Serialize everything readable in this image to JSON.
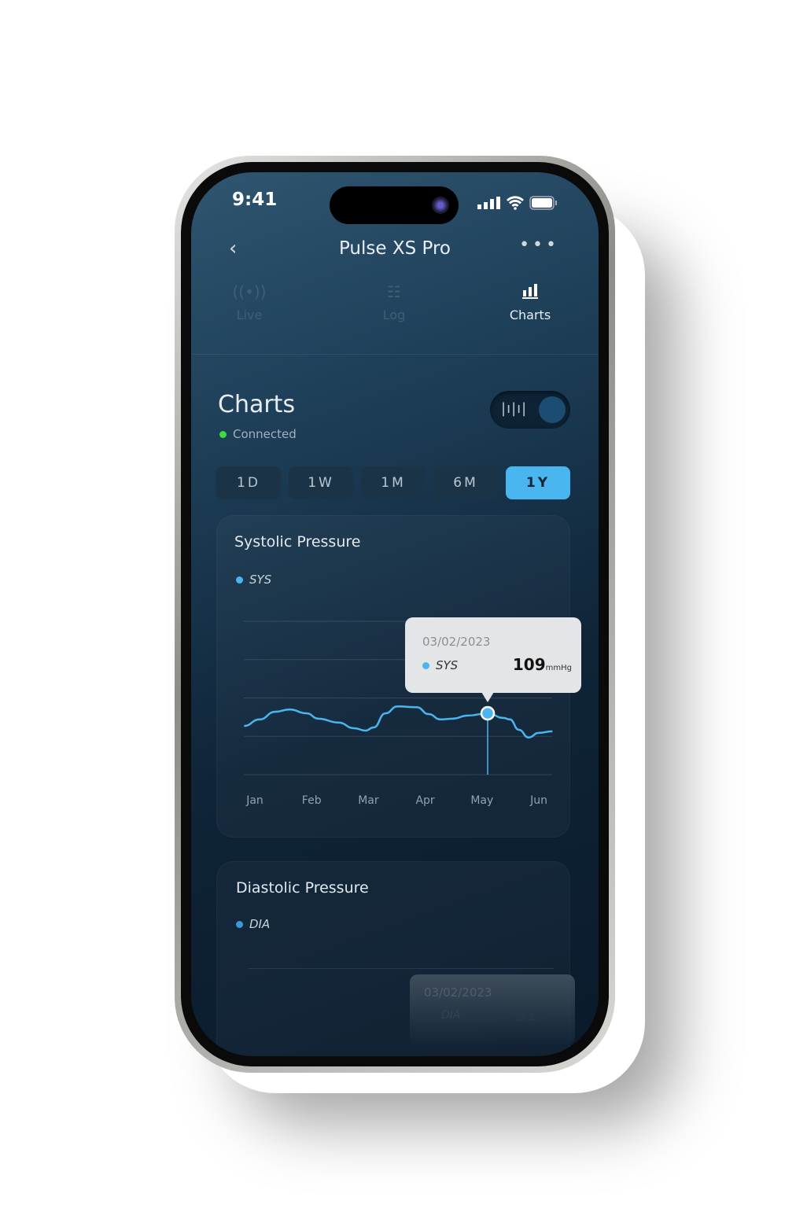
{
  "status_bar": {
    "time": "9:41"
  },
  "header": {
    "title": "Pulse XS Pro",
    "back_icon": "chevron-left-icon",
    "more_icon": "ellipsis-icon"
  },
  "tabs": [
    {
      "label": "Live",
      "icon": "broadcast-icon",
      "active": false
    },
    {
      "label": "Log",
      "icon": "document-icon",
      "active": false
    },
    {
      "label": "Charts",
      "icon": "bar-chart-icon",
      "active": true
    }
  ],
  "page": {
    "title": "Charts",
    "status": "Connected",
    "status_color": "#3ddc3d",
    "toggle_icon": "bars-icon"
  },
  "ranges": [
    {
      "label": "1D",
      "active": false
    },
    {
      "label": "1W",
      "active": false
    },
    {
      "label": "1M",
      "active": false
    },
    {
      "label": "6M",
      "active": false
    },
    {
      "label": "1Y",
      "active": true
    }
  ],
  "accent": "#4ab6f0",
  "systolic": {
    "title": "Systolic Pressure",
    "legend": "SYS",
    "tooltip": {
      "date": "03/02/2023",
      "series": "SYS",
      "value": "109",
      "unit": "mmHg"
    }
  },
  "diastolic": {
    "title": "Diastolic Pressure",
    "legend": "DIA",
    "tooltip": {
      "date": "03/02/2023",
      "series": "DIA",
      "value": "91"
    }
  },
  "chart_data": {
    "type": "line",
    "categories": [
      "Jan",
      "Feb",
      "Mar",
      "Apr",
      "May",
      "Jun"
    ],
    "ylabel": "",
    "xlabel": "",
    "grid": true,
    "ylim": [
      93,
      133
    ],
    "series": [
      {
        "name": "SYS",
        "color": "#4ab6f0",
        "points": [
          [
            -0.19,
            105.7
          ],
          [
            0.08,
            107.4
          ],
          [
            0.36,
            109.4
          ],
          [
            0.61,
            110.0
          ],
          [
            0.91,
            109.0
          ],
          [
            1.12,
            107.6
          ],
          [
            1.47,
            106.6
          ],
          [
            1.75,
            105.1
          ],
          [
            1.95,
            104.5
          ],
          [
            2.09,
            105.3
          ],
          [
            2.3,
            109.0
          ],
          [
            2.51,
            110.8
          ],
          [
            2.85,
            110.6
          ],
          [
            3.06,
            108.8
          ],
          [
            3.27,
            107.4
          ],
          [
            3.48,
            107.6
          ],
          [
            3.75,
            108.4
          ],
          [
            4.1,
            109.0
          ],
          [
            4.38,
            107.8
          ],
          [
            4.49,
            107.4
          ],
          [
            4.65,
            104.7
          ],
          [
            4.82,
            102.7
          ],
          [
            5.0,
            103.9
          ],
          [
            5.24,
            104.3
          ]
        ]
      }
    ],
    "highlight": {
      "x": 4.1,
      "y": 109
    }
  }
}
